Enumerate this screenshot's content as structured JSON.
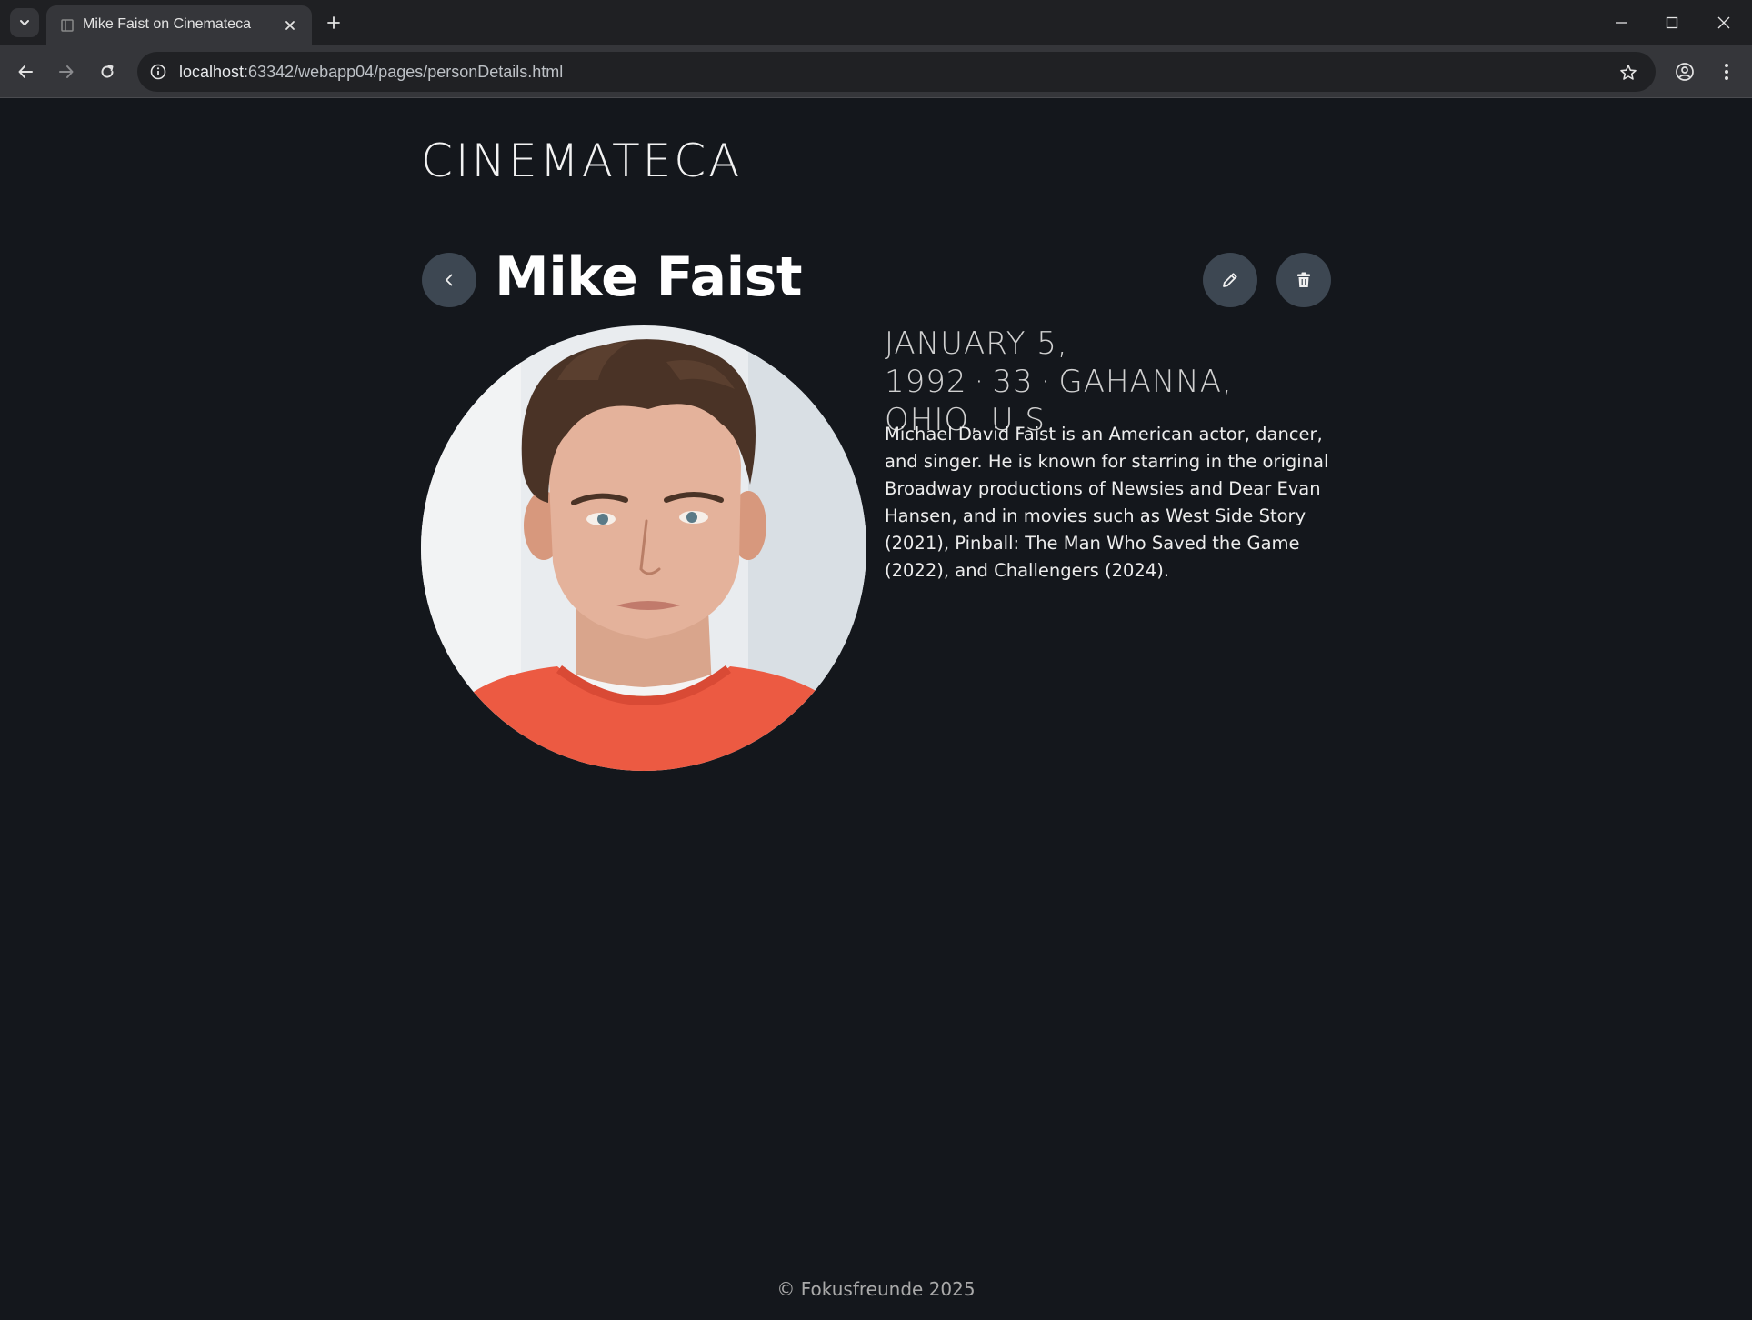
{
  "browser": {
    "tab_title": "Mike Faist on Cinemateca",
    "url_host": "localhost",
    "url_rest": ":63342/webapp04/pages/personDetails.html"
  },
  "site": {
    "brand": "CINEMATECA"
  },
  "person": {
    "name": "Mike Faist",
    "birth_date": "January 5, 1992",
    "age": "33",
    "birthplace": "Gahanna, Ohio, U.S.",
    "separator": "·",
    "bio": "Michael David Faist is an American actor, dancer, and singer. He is known for starring in the original Broadway productions of Newsies and Dear Evan Hansen, and in movies such as West Side Story (2021), Pinball: The Man Who Saved the Game (2022), and Challengers (2024)."
  },
  "footer": {
    "text": "© Fokusfreunde 2025"
  },
  "colors": {
    "background": "#14171c",
    "button_bg": "#3d4752",
    "chrome_dark": "#1f2023",
    "chrome_tab": "#35363a"
  },
  "icons": {
    "back": "chevron-left-icon",
    "edit": "pencil-icon",
    "delete": "trash-icon"
  }
}
